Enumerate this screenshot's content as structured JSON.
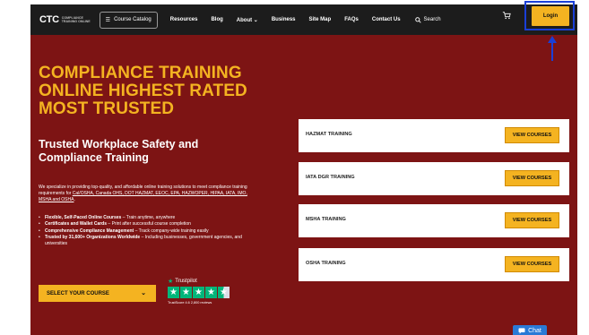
{
  "nav": {
    "logo_text": "CTC",
    "logo_sub": "COMPLIANCE TRAINING ONLINE",
    "catalog_label": "Course Catalog",
    "links": [
      "Resources",
      "Blog",
      "About",
      "Business",
      "Site Map",
      "FAQs",
      "Contact Us"
    ],
    "about_chevron": "⌄",
    "search_label": "Search",
    "login_label": "Login"
  },
  "hero": {
    "headline_lines": [
      "COMPLIANCE TRAINING",
      "ONLINE HIGHEST RATED",
      "MOST TRUSTED"
    ],
    "subhead": "Trusted Workplace Safety and Compliance Training",
    "intro_prefix": "We specialize in providing top-quality, and affordable online training solutions to meet compliance training requirements for ",
    "intro_links": "Cal/OSHA, Canada OHS, DOT HAZMAT, EEOC, EPA, HAZWOPER, HIPAA, IATA, IMO, MSHA and OSHA",
    "intro_suffix": ".",
    "bullets": [
      {
        "bold": "Flexible, Self-Paced Online Courses",
        "text": " – Train anytime, anywhere"
      },
      {
        "bold": "Certificates and Wallet Cards",
        "text": " – Print after successful course completion"
      },
      {
        "bold": "Comprehensive Compliance Management",
        "text": " – Track company-wide training easily"
      },
      {
        "bold": "Trusted by 31,600+ Organizations Worldwide",
        "text": " – Including businesses, government agencies, and universities"
      }
    ],
    "select_label": "SELECT YOUR COURSE",
    "trustpilot_label": "Trustpilot",
    "trustpilot_rating": 4.6,
    "trustpilot_score": "TrustScore 4.6 2,800 reviews"
  },
  "cards": [
    {
      "title": "HAZMAT TRAINING",
      "button": "VIEW COURSES"
    },
    {
      "title": "IATA DGR TRAINING",
      "button": "VIEW COURSES"
    },
    {
      "title": "MSHA TRAINING",
      "button": "VIEW COURSES"
    },
    {
      "title": "OSHA TRAINING",
      "button": "VIEW COURSES"
    }
  ],
  "chat": {
    "label": "Chat"
  },
  "colors": {
    "hero_bg": "#7d1414",
    "accent": "#f4b321",
    "nav_bg": "#1c1c1c",
    "annotation": "#1a3fd6",
    "trustpilot_green": "#00b67a"
  },
  "icons": {
    "catalog": "menu-icon",
    "search": "search-icon",
    "cart": "cart-icon",
    "chat": "chat-icon",
    "select": "chevron-down-icon"
  }
}
